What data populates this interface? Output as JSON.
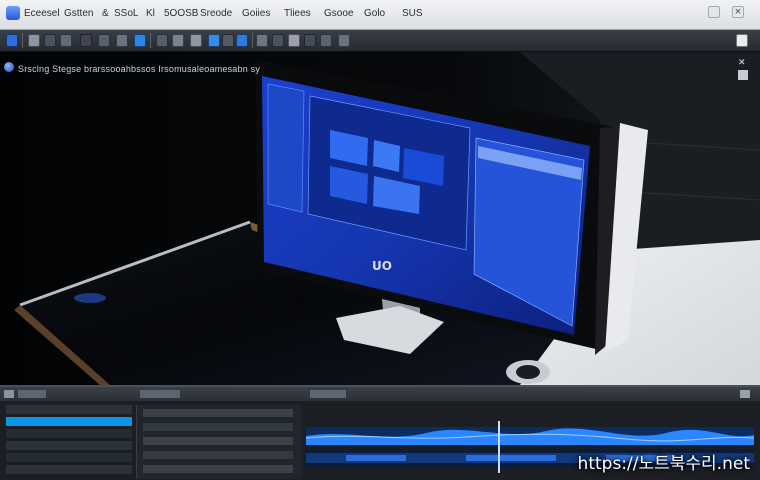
{
  "window": {
    "menu": [
      "Eceesel",
      "Gstten",
      "&",
      "SSoL",
      "Kl",
      "5OOSB",
      "Sreode",
      "Goiies",
      "Tliees",
      "Gsooe",
      "Golo",
      "SUS"
    ],
    "accent": "#2e63ff"
  },
  "viewport": {
    "title": "Srsclng Stegse brarssooahbssos Irsomusaleoamesabn sy"
  },
  "photo": {
    "monitor_logo": "UO"
  },
  "watermark": "https://노트북수리.net"
}
